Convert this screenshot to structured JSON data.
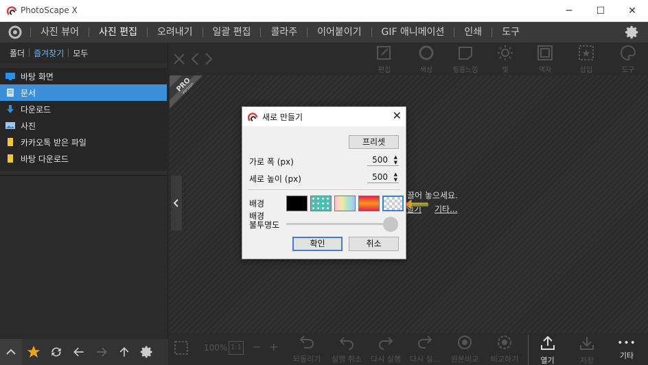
{
  "window": {
    "title": "PhotoScape X",
    "minimize_glyph": "─",
    "maximize_glyph": "☐",
    "close_glyph": "✕"
  },
  "menu": {
    "items": [
      "사진 뷰어",
      "사진 편집",
      "오려내기",
      "일괄 편집",
      "콜라주",
      "이어붙이기",
      "GIF 애니메이션",
      "인쇄",
      "도구"
    ],
    "active_index": 1
  },
  "left_panel": {
    "tabs": [
      "폴더",
      "즐겨찾기",
      "모두"
    ],
    "active_tab": 1,
    "favorites": [
      {
        "label": "바탕 화면",
        "icon": "desktop-icon"
      },
      {
        "label": "문서",
        "icon": "document-icon",
        "selected": true
      },
      {
        "label": "다운로드",
        "icon": "download-icon"
      },
      {
        "label": "사진",
        "icon": "picture-icon"
      },
      {
        "label": "카카오톡 받은 파일",
        "icon": "folder-icon"
      },
      {
        "label": "바탕 다운로드",
        "icon": "folder-icon"
      }
    ]
  },
  "toolbar": {
    "items": [
      "편집",
      "색상",
      "필름느낌",
      "빛",
      "액자",
      "삽입",
      "도구"
    ]
  },
  "canvas": {
    "pro_badge_main": "PRO",
    "pro_badge_sub": "Version",
    "hint_text": "끌어 놓으세요.",
    "hint_link1": "열기",
    "hint_link2": "기타..."
  },
  "bottombar": {
    "zoom": "100%",
    "fit": "1:1",
    "minus": "−",
    "plus": "+",
    "actions": [
      "되돌리기",
      "실행 취소",
      "다시 실행",
      "다시 실...",
      "원본비교",
      "비교하기"
    ],
    "open": "열기",
    "save": "저장",
    "more": "기타",
    "more_glyph": "•••"
  },
  "dialog": {
    "title": "새로 만들기",
    "close_glyph": "✕",
    "preset_label": "프리셋",
    "width_label": "가로 폭 (px)",
    "width_value": "500",
    "height_label": "세로 높이 (px)",
    "height_value": "500",
    "background_label": "배경",
    "opacity_label_1": "배경",
    "opacity_label_2": "불투명도",
    "opacity_value": 1.0,
    "ok_label": "확인",
    "cancel_label": "취소",
    "swatches": [
      "black",
      "teal-dots",
      "pastel-gradient",
      "red-orange-gradient",
      "transparent-checker"
    ],
    "selected_swatch": 4
  },
  "colors": {
    "accent": "#3d8fd8",
    "active_tab": "#6bb8ff",
    "star": "#f0a020"
  }
}
